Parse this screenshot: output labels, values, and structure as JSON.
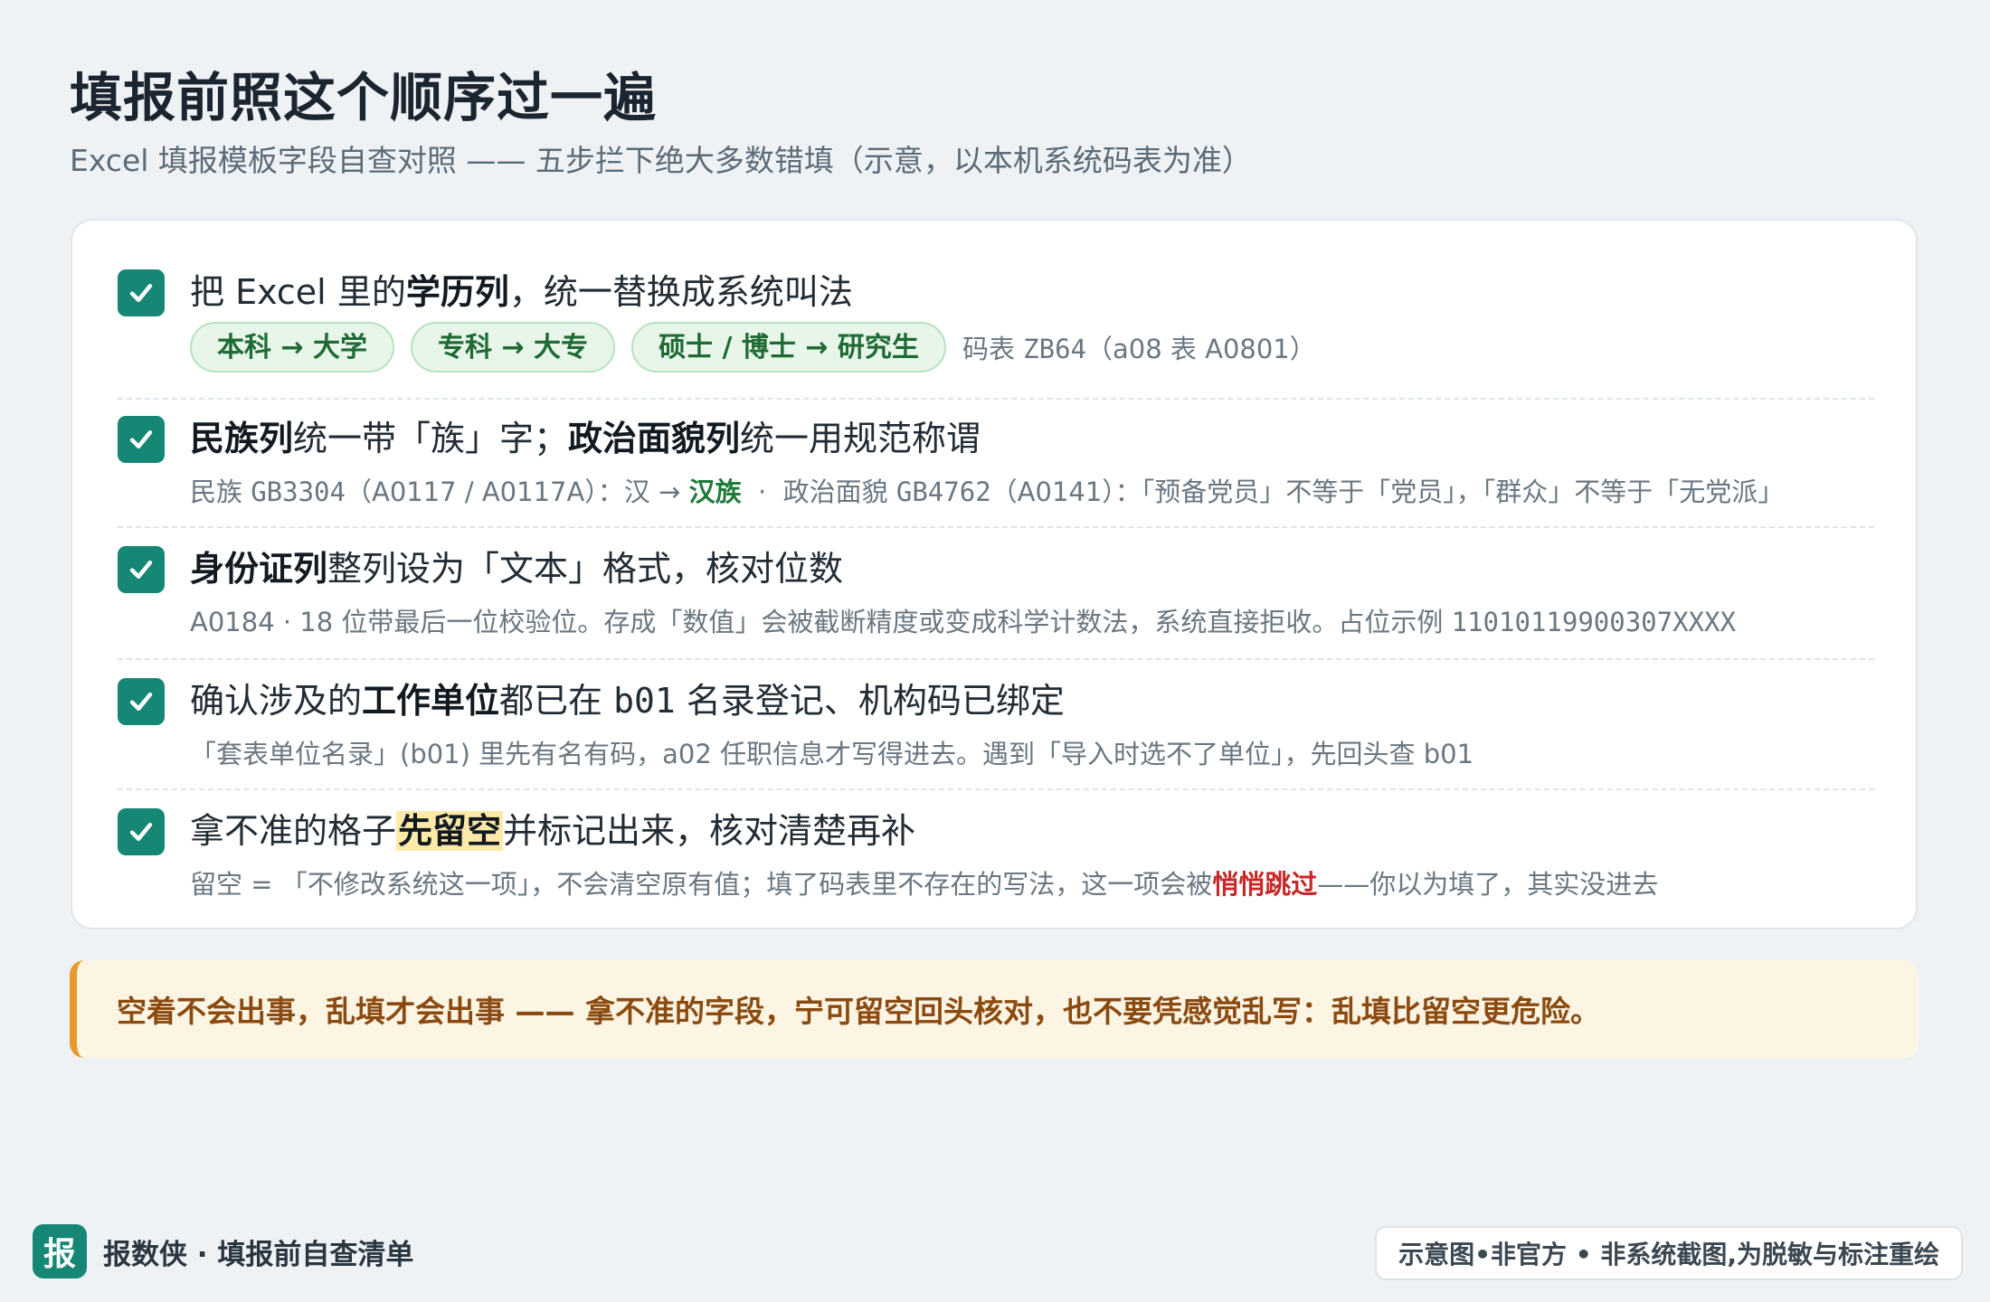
{
  "header": {
    "title": "填报前照这个顺序过一遍",
    "subtitle": "Excel 填报模板字段自查对照 —— 五步拦下绝大多数错填（示意，以本机系统码表为准）"
  },
  "checklist": {
    "items": [
      {
        "title_pre": "把 Excel 里的",
        "title_bold": "学历列",
        "title_post": "，统一替换成系统叫法",
        "chips": [
          "本科 → 大学",
          "专科 → 大专",
          "硕士 / 博士 → 研究生"
        ],
        "chip_note_pre": "码表 ",
        "chip_note_code": "ZB64",
        "chip_note_post": "（a08 表 A0801）"
      },
      {
        "title_bold1": "民族列",
        "title_mid1": "统一带「族」字；",
        "title_bold2": "政治面貌列",
        "title_post": "统一用规范称谓",
        "desc_pre": "民族 ",
        "desc_code1": "GB3304",
        "desc_mid1": "（A0117 / A0117A）：汉 → ",
        "desc_green": "汉族",
        "desc_mid2": "  ·  政治面貌 ",
        "desc_code2": "GB4762",
        "desc_post": "（A0141）：「预备党员」不等于「党员」，「群众」不等于「无党派」"
      },
      {
        "title_bold": "身份证列",
        "title_post": "整列设为「文本」格式，核对位数",
        "desc_pre": "A0184 · 18 位带最后一位校验位。存成「数值」会被截断精度或变成科学计数法，系统直接拒收。占位示例 ",
        "desc_code": "11010119900307XXXX"
      },
      {
        "title_pre": "确认涉及的",
        "title_bold": "工作单位",
        "title_mid": "都已在 ",
        "title_code": "b01",
        "title_post": " 名录登记、机构码已绑定",
        "desc": "「套表单位名录」(b01) 里先有名有码，a02 任职信息才写得进去。遇到「导入时选不了单位」，先回头查 b01"
      },
      {
        "title_pre": "拿不准的格子",
        "title_hl": "先留空",
        "title_post": "并标记出来，核对清楚再补",
        "desc_pre": "留空 = 「不修改系统这一项」，不会清空原有值；填了码表里不存在的写法，这一项会被",
        "desc_red": "悄悄跳过",
        "desc_post": "——你以为填了，其实没进去"
      }
    ]
  },
  "callout": {
    "text": "空着不会出事，乱填才会出事 —— 拿不准的字段，宁可留空回头核对，也不要凭感觉乱写：乱填比留空更危险。"
  },
  "footer": {
    "logo_char": "报",
    "brand": "报数侠 · 填报前自查清单",
    "badge": "示意图•非官方 • 非系统截图,为脱敏与标注重绘"
  },
  "colors": {
    "accent": "#168775",
    "chip_bg": "#e8f6ea",
    "callout_bg": "#fdf5e4",
    "callout_border": "#e79a2c",
    "warn": "#c62828"
  }
}
